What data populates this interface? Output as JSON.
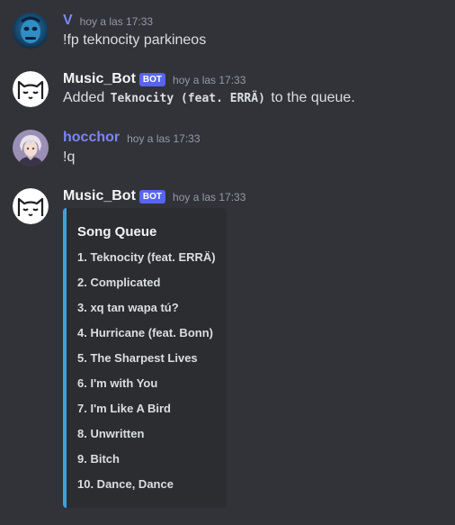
{
  "messages": [
    {
      "username": "V",
      "username_color": "#7b86f7",
      "timestamp": "hoy a las 17:33",
      "content": "!fp teknocity parkineos",
      "avatar_icon": "blue-face-avatar"
    },
    {
      "username": "Music_Bot",
      "username_color": "#f2f3f5",
      "bot_tag": "BOT",
      "timestamp": "hoy a las 17:33",
      "content_prefix": "Added",
      "content_code": "Teknocity (feat. ERRÄ)",
      "content_suffix": "to the queue.",
      "avatar_icon": "cat-face-avatar"
    },
    {
      "username": "hocchor",
      "username_color": "#7b86f7",
      "timestamp": "hoy a las 17:33",
      "content": "!q",
      "avatar_icon": "anime-character-avatar"
    },
    {
      "username": "Music_Bot",
      "username_color": "#f2f3f5",
      "bot_tag": "BOT",
      "timestamp": "hoy a las 17:33",
      "avatar_icon": "cat-face-avatar"
    }
  ],
  "embed": {
    "title": "Song Queue",
    "accent_color": "#3ba0e0",
    "items": [
      "1. Teknocity (feat. ERRÄ)",
      "2. Complicated",
      "3. xq tan wapa tú?",
      "4. Hurricane (feat. Bonn)",
      "5. The Sharpest Lives",
      "6. I'm with You",
      "7. I'm Like A Bird",
      "8. Unwritten",
      "9. Bitch",
      "10. Dance, Dance"
    ]
  },
  "colors": {
    "background": "#313338",
    "embed_background": "#2b2d31",
    "bot_tag": "#5865f2",
    "timestamp": "#949ba4"
  }
}
